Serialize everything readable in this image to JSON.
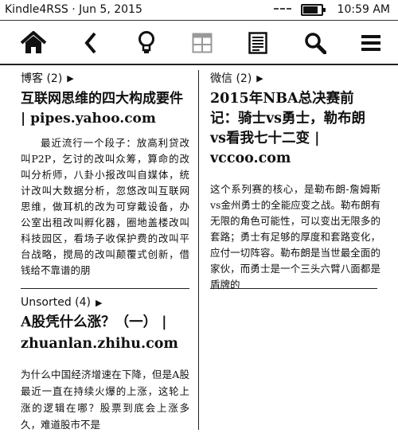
{
  "status": {
    "left": "Kindle4RSS · Jun 5, 2015",
    "time": "10:59 AM",
    "battery_level": 0.8
  },
  "toolbar": {
    "items": [
      {
        "icon": "home-icon"
      },
      {
        "icon": "back-icon"
      },
      {
        "icon": "lightbulb-icon"
      },
      {
        "icon": "grid-view-icon"
      },
      {
        "icon": "article-list-icon"
      },
      {
        "icon": "search-icon"
      },
      {
        "icon": "menu-icon"
      }
    ]
  },
  "cards": [
    {
      "category": "博客 (2)",
      "title": "互联网思维的四大构成要件 | pipes.yahoo.com",
      "snippet": "最近流行一个段子：放高利贷改叫P2P，乞讨的改叫众筹，算命的改叫分析师，八卦小报改叫自媒体，统计改叫大数据分析，忽悠改叫互联网思维，做耳机的改为可穿戴设备，办公室出租改叫孵化器，圈地盖楼改叫科技园区，看场子收保护费的改叫平台战略，搅局的改叫颠覆式创新，借钱给不靠谱的朋"
    },
    {
      "category": "微信 (2)",
      "title": "2015年NBA总决赛前记：骑士vs勇士，勒布朗vs看我七十二变 | vccoo.com",
      "snippet": "这个系列赛的核心，是勒布朗-詹姆斯vs金州勇士的全能应变之战。勒布朗有无限的角色可能性，可以变出无限多的套路；勇士有足够的厚度和套路变化，应付一切阵容。勒布朗是当世最全面的家伙，而勇士是一个三头六臂八面都是盾牌的"
    },
    {
      "category": "Unsorted (4)",
      "title": "A股凭什么涨？（一） | zhuanlan.zhihu.com",
      "snippet": "为什么中国经济增速在下降，但是A股最近一直在持续火爆的上涨，这轮上涨的逻辑在哪？股票到底会上涨多久，难道股市不是"
    }
  ]
}
